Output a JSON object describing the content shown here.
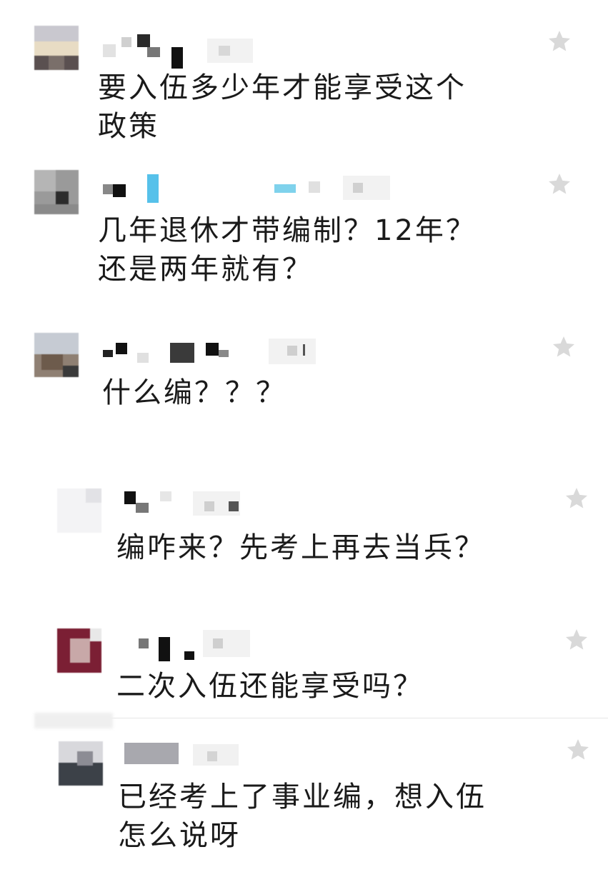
{
  "comments": [
    {
      "text": "要入伍多少年才能享受这个\n政策",
      "star": "star-icon"
    },
    {
      "text": "几年退休才带编制？12年？\n还是两年就有？",
      "star": "star-icon"
    },
    {
      "text": "什么编？？？",
      "star": "star-icon"
    },
    {
      "text": "编咋来？先考上再去当兵？",
      "star": "star-icon"
    },
    {
      "text": "二次入伍还能享受吗？",
      "star": "star-icon"
    },
    {
      "text": "已经考上了事业编，想入伍\n怎么说呀",
      "star": "star-icon"
    }
  ],
  "colors": {
    "text": "#1a1a1a",
    "star": "#d9d9d9",
    "background": "#ffffff"
  }
}
